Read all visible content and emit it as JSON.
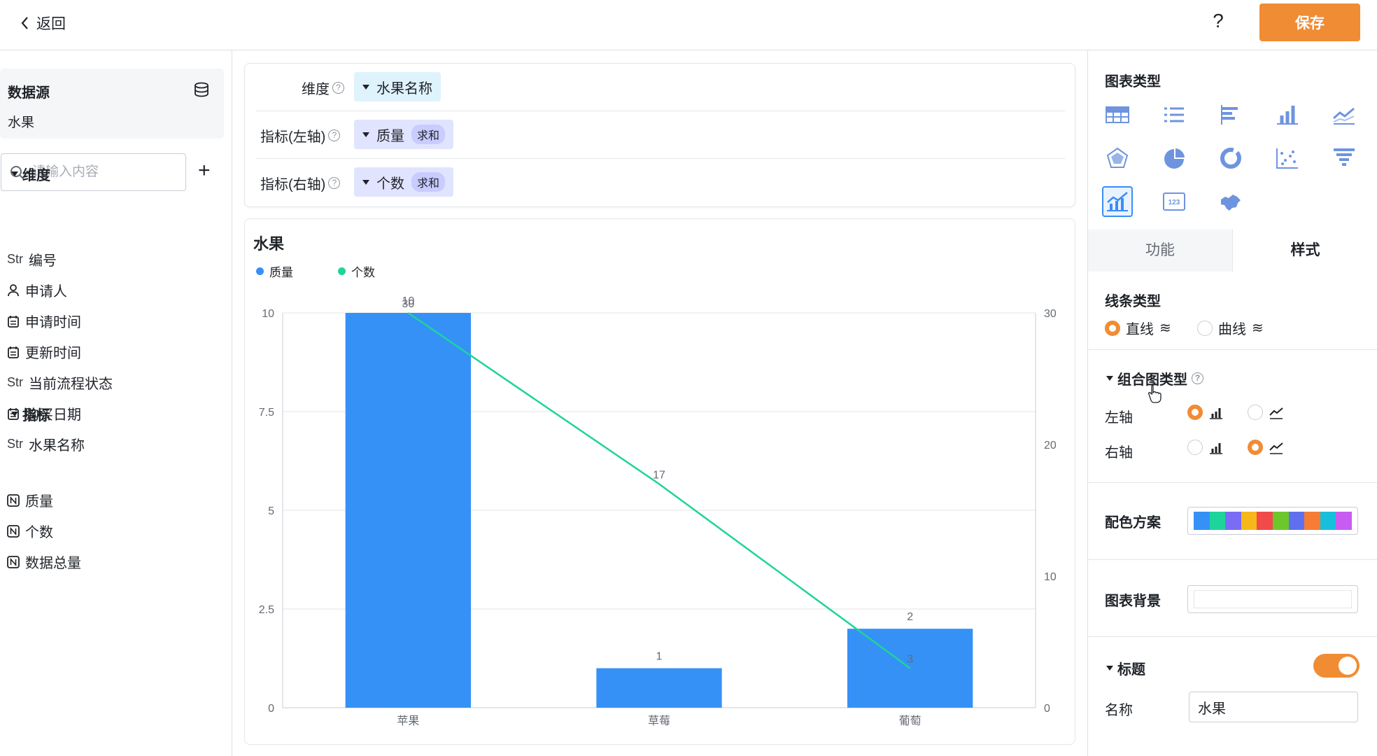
{
  "topbar": {
    "back_label": "返回",
    "help_label": "?",
    "save_label": "保存"
  },
  "sidebar": {
    "datasource_title": "数据源",
    "datasource_name": "水果",
    "search_placeholder": "请输入内容",
    "add_label": "+",
    "dimensions_title": "维度",
    "dimensions": [
      {
        "type": "Str",
        "label": "编号",
        "icon": "string-icon"
      },
      {
        "type": "",
        "label": "申请人",
        "icon": "user-icon"
      },
      {
        "type": "",
        "label": "申请时间",
        "icon": "calendar-icon"
      },
      {
        "type": "",
        "label": "更新时间",
        "icon": "calendar-icon"
      },
      {
        "type": "Str",
        "label": "当前流程状态",
        "icon": "string-icon"
      },
      {
        "type": "",
        "label": "购买日期",
        "icon": "calendar-icon"
      },
      {
        "type": "Str",
        "label": "水果名称",
        "icon": "string-icon"
      }
    ],
    "metrics_title": "指标",
    "metrics": [
      {
        "label": "质量",
        "icon": "number-icon"
      },
      {
        "label": "个数",
        "icon": "number-icon"
      },
      {
        "label": "数据总量",
        "icon": "number-icon"
      }
    ]
  },
  "config": {
    "dimension_label": "维度",
    "dimension_value": "水果名称",
    "left_metric_label": "指标(左轴)",
    "left_metric_value": "质量",
    "left_metric_agg": "求和",
    "right_metric_label": "指标(右轴)",
    "right_metric_value": "个数",
    "right_metric_agg": "求和"
  },
  "chart_data": {
    "type": "bar",
    "title": "水果",
    "categories": [
      "苹果",
      "草莓",
      "葡萄"
    ],
    "series": [
      {
        "name": "质量",
        "type": "bar",
        "axis": "left",
        "values": [
          10,
          1,
          2
        ],
        "color": "#3591f6"
      },
      {
        "name": "个数",
        "type": "line",
        "axis": "right",
        "values": [
          30,
          17,
          3
        ],
        "color": "#1ed49a"
      }
    ],
    "left_axis": {
      "ylim": [
        0,
        10
      ],
      "ticks": [
        "0",
        "2.5",
        "5",
        "7.5",
        "10"
      ]
    },
    "right_axis": {
      "ylim": [
        0,
        30
      ],
      "ticks": [
        "0",
        "10",
        "20",
        "30"
      ]
    },
    "grid": true,
    "legend": "top-left"
  },
  "panel": {
    "chart_type_title": "图表类型",
    "chart_types": [
      "table-icon",
      "list-icon",
      "horizontal-bar-icon",
      "bar-icon",
      "line-icon",
      "radar-icon",
      "pie-icon",
      "donut-icon",
      "scatter-icon",
      "funnel-icon",
      "combo-chart-icon",
      "number-card-icon",
      "map-icon"
    ],
    "selected_chart_type": "combo-chart-icon",
    "tab_function": "功能",
    "tab_style": "样式",
    "line_type_title": "线条类型",
    "line_straight": "直线",
    "line_curve": "曲线",
    "combo_title": "组合图类型",
    "left_axis_label": "左轴",
    "right_axis_label": "右轴",
    "color_scheme_label": "配色方案",
    "color_scheme": [
      "#3591f6",
      "#1ed49a",
      "#7b6cf6",
      "#f5b71a",
      "#f2494b",
      "#6dc72a",
      "#5f6ff0",
      "#f67c36",
      "#16bfdc",
      "#c85cf2"
    ],
    "background_label": "图表背景",
    "title_section": "标题",
    "name_label": "名称",
    "name_value": "水果"
  }
}
